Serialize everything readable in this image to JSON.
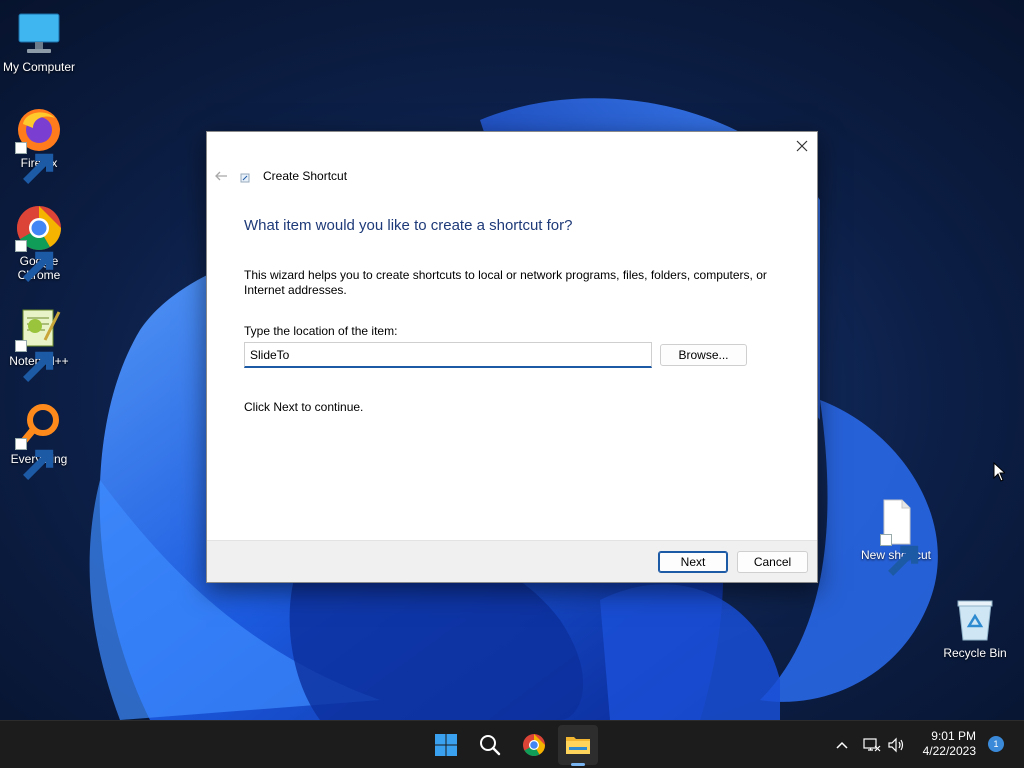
{
  "desktop": {
    "icons": [
      {
        "label": "My Computer",
        "icon": "monitor-icon"
      },
      {
        "label": "Firefox",
        "icon": "firefox-icon"
      },
      {
        "label": "Google Chrome",
        "icon": "chrome-icon"
      },
      {
        "label": "Notepad++",
        "icon": "notepad-plus-plus-icon"
      },
      {
        "label": "Everything",
        "icon": "everything-search-icon"
      },
      {
        "label": "New shortcut",
        "icon": "blank-file-icon"
      },
      {
        "label": "Recycle Bin",
        "icon": "recycle-bin-icon"
      }
    ]
  },
  "dialog": {
    "title": "Create Shortcut",
    "heading": "What item would you like to create a shortcut for?",
    "intro": "This wizard helps you to create shortcuts to local or network programs, files, folders, computers, or Internet addresses.",
    "location_label": "Type the location of the item:",
    "location_value": "SlideTo",
    "browse_label": "Browse...",
    "continue_text": "Click Next to continue.",
    "next_label": "Next",
    "cancel_label": "Cancel"
  },
  "taskbar": {
    "apps": [
      "windows-start-icon",
      "search-icon",
      "chrome-icon",
      "file-explorer-icon"
    ],
    "time": "9:01 PM",
    "date": "4/22/2023",
    "notification_count": "1"
  },
  "colors": {
    "heading": "#1e3a78",
    "accent": "#1d5aa6",
    "taskbar": "#1c1c1c"
  }
}
